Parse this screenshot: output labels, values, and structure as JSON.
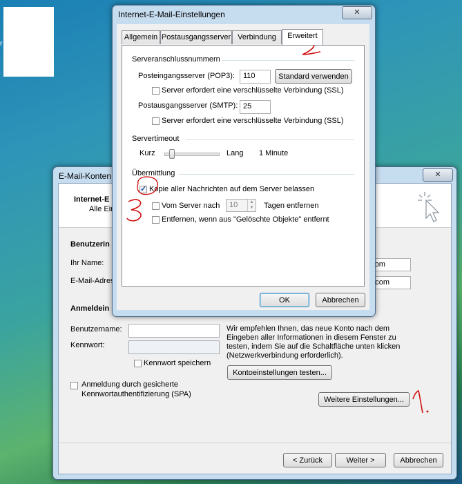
{
  "desktop": {
    "side_glyph": "r"
  },
  "back_dialog": {
    "title": "E-Mail-Konten",
    "header_title": "Internet-E",
    "header_sub": "Alle Ein",
    "section_user": "Benutzerin",
    "label_name": "Ihr Name:",
    "label_email": "E-Mail-Adress",
    "value_name_suffix": "o.com",
    "value_email_suffix": "oo.com",
    "section_login": "Anmeldein",
    "label_username": "Benutzername:",
    "label_password": "Kennwort:",
    "save_password": "Kennwort speichern",
    "spa_line1": "Anmeldung durch gesicherte",
    "spa_line2": "Kennwortauthentifizierung (SPA)",
    "recommend_text": [
      "Wir empfehlen Ihnen, das neue Konto nach dem",
      "Eingeben aller Informationen in diesem Fenster zu",
      "testen, indem Sie auf die Schaltfläche unten klicken",
      "(Netzwerkverbindung erforderlich)."
    ],
    "test_button": "Kontoeinstellungen testen...",
    "more_settings_button": "Weitere Einstellungen...",
    "back_button": "< Zurück",
    "next_button": "Weiter >",
    "cancel_button": "Abbrechen",
    "close_glyph": "✕"
  },
  "front_dialog": {
    "title": "Internet-E-Mail-Einstellungen",
    "close_glyph": "✕",
    "tabs": [
      "Allgemein",
      "Postausgangsserver",
      "Verbindung",
      "Erweitert"
    ],
    "active_tab": "Erweitert",
    "group_ports": "Serveranschlussnummern",
    "label_pop3": "Posteingangsserver (POP3):",
    "value_pop3": "110",
    "standard_button": "Standard verwenden",
    "ssl_in": "Server erfordert eine verschlüsselte Verbindung (SSL)",
    "label_smtp": "Postausgangsserver (SMTP):",
    "value_smtp": "25",
    "ssl_out": "Server erfordert eine verschlüsselte Verbindung (SSL)",
    "group_timeout": "Servertimeout",
    "timeout_short": "Kurz",
    "timeout_long": "Lang",
    "timeout_value": "1 Minute",
    "timeout_level": 0.1,
    "group_delivery": "Übermittlung",
    "keep_copy": "Kopie aller Nachrichten auf dem Server belassen",
    "keep_copy_checked": true,
    "remove_after_prefix": "Vom Server nach",
    "remove_after_days": "10",
    "remove_after_suffix": "Tagen entfernen",
    "remove_deleted": "Entfernen, wenn aus \"Gelöschte Objekte\" entfernt",
    "ok_button": "OK",
    "cancel_button": "Abbrechen"
  },
  "annotations": {
    "mark_2": "2",
    "mark_3": "3",
    "mark_1": "1",
    "color": "#d01010"
  }
}
